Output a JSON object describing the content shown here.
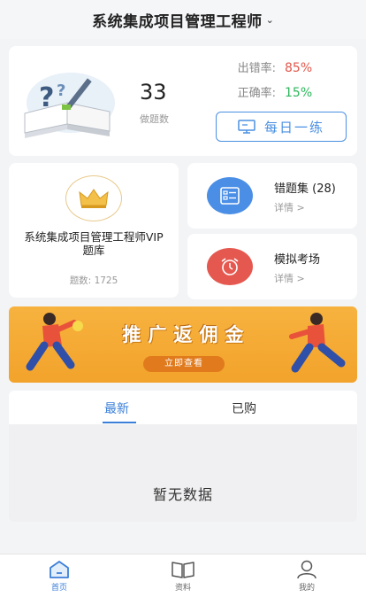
{
  "header": {
    "title": "系统集成项目管理工程师",
    "caret_icon": "chevron-down-icon"
  },
  "stats": {
    "count": "33",
    "count_label": "做题数",
    "error_rate_label": "出错率:",
    "error_rate_value": "85%",
    "correct_rate_label": "正确率:",
    "correct_rate_value": "15%",
    "daily_button": "每日一练",
    "colors": {
      "error": "#e2574c",
      "correct": "#2cb65a",
      "accent": "#4a90e2"
    }
  },
  "vip": {
    "title": "系统集成项目管理工程师VIP题库",
    "count_label": "题数: 1725"
  },
  "wrong_set": {
    "title": "错题集 (28)",
    "detail": "详情 >"
  },
  "mock_exam": {
    "title": "模拟考场",
    "detail": "详情 >"
  },
  "banner": {
    "title": "推广返佣金",
    "button": "立即查看"
  },
  "tabs": {
    "items": [
      "最新",
      "已购"
    ],
    "active": "最新",
    "empty_text": "暂无数据"
  },
  "bottom_nav": [
    {
      "label": "首页",
      "icon": "home-icon",
      "active": true
    },
    {
      "label": "资料",
      "icon": "book-icon",
      "active": false
    },
    {
      "label": "我的",
      "icon": "user-icon",
      "active": false
    }
  ]
}
